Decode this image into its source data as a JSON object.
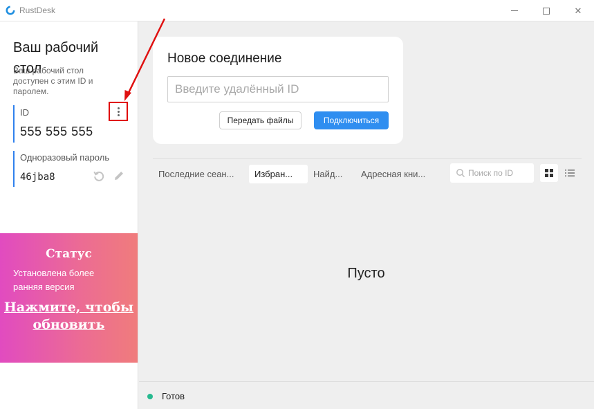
{
  "window": {
    "title": "RustDesk",
    "logo_icon": "rustdesk-logo-icon",
    "minimize_icon": "minimize-icon",
    "maximize_icon": "maximize-icon",
    "close_symbol": "✕"
  },
  "left_panel": {
    "title": "Ваш рабочий стол",
    "description": "Ваш рабочий стол доступен с этим ID и паролем.",
    "id_label": "ID",
    "id_value": "555 555 555",
    "menu_icon": "more-vertical-icon",
    "password_label": "Одноразовый пароль",
    "password_value": "46jba8",
    "accent_color": "#2f80ed"
  },
  "status_card": {
    "title": "Статус",
    "text": "Установлена более ранняя версия",
    "link": "Нажмите, чтобы обновить"
  },
  "connection": {
    "title": "Новое соединение",
    "input_value": "",
    "input_placeholder": "Введите удалённый ID",
    "transfer_button": "Передать файлы",
    "connect_button": "Подключиться",
    "connect_color": "#2f8ef0"
  },
  "tabs": {
    "items": [
      {
        "label": "Последние сеан..."
      },
      {
        "label": "Избран...",
        "active": true
      },
      {
        "label": "Найд..."
      },
      {
        "label": "Адресная кни..."
      }
    ],
    "search_placeholder": "Поиск по ID",
    "search_value": ""
  },
  "main": {
    "empty_text": "Пусто"
  },
  "footer": {
    "status": "Готов",
    "status_color": "#26b98f"
  }
}
